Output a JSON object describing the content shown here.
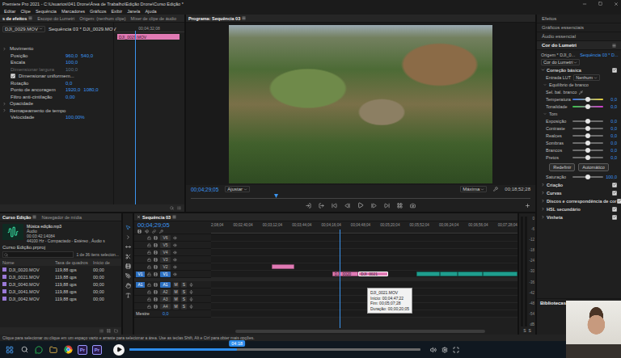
{
  "window": {
    "title": "Premiere Pro 2021 - C:\\Usuarios\\041 Drone\\Área de Trabalho\\Edição Drone\\Curso Edição *"
  },
  "menu": [
    "Editar",
    "Clipe",
    "Sequência",
    "Marcadores",
    "Gráficos",
    "Exibir",
    "Janela",
    "Ajuda"
  ],
  "effect_controls": {
    "tabs": [
      {
        "label": "s de efeitos",
        "selected": true
      },
      {
        "label": "Escopo do Lumetri",
        "selected": false
      },
      {
        "label": "Origem: (nenhum clipe)",
        "selected": false
      },
      {
        "label": "Mixer de clipe de áudio",
        "selected": false
      }
    ],
    "source": "DJI_0029.MOV",
    "sequence": "Sequência 03 * DJI_0029.MOV",
    "ruler_time": "00;04;32;08",
    "clip": "DJI_0029.MOV",
    "playhead": 0.3,
    "rows": [
      {
        "kind": "section",
        "label": "Movimento",
        "disabled": false
      },
      {
        "kind": "value",
        "label": "Posição",
        "values": [
          "960,0",
          "540,0"
        ],
        "disabled": false
      },
      {
        "kind": "value",
        "label": "Escala",
        "values": [
          "100,0"
        ],
        "disabled": false
      },
      {
        "kind": "value",
        "label": "Dimensionar largura",
        "values": [
          "100,0"
        ],
        "disabled": true
      },
      {
        "kind": "check",
        "label": "Dimensionar uniformem...",
        "checked": true,
        "disabled": false
      },
      {
        "kind": "value",
        "label": "Rotação",
        "values": [
          "0,0"
        ],
        "disabled": false
      },
      {
        "kind": "value",
        "label": "Ponto de ancoragem",
        "values": [
          "1920,0",
          "1080,0"
        ],
        "disabled": false
      },
      {
        "kind": "value",
        "label": "Filtro anti-cintilação",
        "values": [
          "0,00"
        ],
        "disabled": false
      },
      {
        "kind": "section",
        "label": "Opacidade",
        "disabled": false
      },
      {
        "kind": "section",
        "label": "Remapeamento de tempo",
        "disabled": false
      },
      {
        "kind": "value",
        "label": "Velocidade",
        "values": [
          "100,00%"
        ],
        "disabled": false
      }
    ]
  },
  "program": {
    "title": "Programa: Sequência 03",
    "timecode": "00;04;29;05",
    "fit": "Ajustar",
    "quality": "Máxima",
    "duration": "00;18;52;28",
    "playhead": 0.25
  },
  "lumetri": {
    "panels": [
      {
        "label": "Efeitos",
        "selected": false
      },
      {
        "label": "Gráficos essenciais",
        "selected": false
      },
      {
        "label": "Áudio essencial",
        "selected": false
      },
      {
        "label": "Cor do Lumetri",
        "selected": true
      }
    ],
    "source": "Origem * DJI_0...",
    "target": "Sequência 03 * D...",
    "effect": "Cor do Lumetri",
    "basic": {
      "label": "Correção básica",
      "checked": true
    },
    "lut_label": "Entrada LUT",
    "lut": "Nenhum",
    "wb": "Equilíbrio de branco",
    "wb_picker": "Sel. bal. branco",
    "wb_sliders": [
      {
        "label": "Temperatura",
        "value": "0,0",
        "level": 0.5,
        "kind": "temperature"
      },
      {
        "label": "Tonalidade",
        "value": "0,0",
        "level": 0.5,
        "kind": "tint"
      }
    ],
    "tone": "Tom",
    "tone_sliders": [
      {
        "label": "Exposição",
        "value": "0,0",
        "level": 0.5,
        "kind": "plain"
      },
      {
        "label": "Contraste",
        "value": "0,0",
        "level": 0.5,
        "kind": "plain"
      },
      {
        "label": "Realces",
        "value": "0,0",
        "level": 0.5,
        "kind": "plain"
      },
      {
        "label": "Sombras",
        "value": "0,0",
        "level": 0.5,
        "kind": "plain"
      },
      {
        "label": "Brancos",
        "value": "0,0",
        "level": 0.5,
        "kind": "plain"
      },
      {
        "label": "Pretos",
        "value": "0,0",
        "level": 0.5,
        "kind": "plain"
      }
    ],
    "buttons": [
      "Redefinir",
      "Automático"
    ],
    "saturation": {
      "label": "Saturação",
      "value": "100,0",
      "level": 0.5,
      "kind": "plain"
    },
    "sections": [
      {
        "label": "Criação",
        "checked": true
      },
      {
        "label": "Curvas",
        "checked": true
      },
      {
        "label": "Discos e correspondência de cor",
        "checked": true
      },
      {
        "label": "HSL secundário",
        "checked": true
      },
      {
        "label": "Vinheta",
        "checked": true
      }
    ],
    "libraries": "Bibliotecas"
  },
  "project": {
    "tabs": [
      {
        "label": "Curso Edição",
        "selected": true
      },
      {
        "label": "Navegador de mídia",
        "selected": false
      }
    ],
    "preview": [
      "Música edição.mp3",
      "Áudio",
      "00:03:42:14084",
      "44100 Hz - Compactado - Estéreo , Áudio s"
    ],
    "file": "Curso Edição.prproj",
    "count": "1 de 36 itens selecion...",
    "columns": [
      "Nome",
      "Taxa de quadros",
      "Início de"
    ],
    "rows": [
      {
        "name": "DJI_0020.MOV",
        "rate": "119,88 qps",
        "start": "00;00",
        "selected": false
      },
      {
        "name": "DJI_0021.MOV",
        "rate": "119,88 qps",
        "start": "00;00",
        "selected": false
      },
      {
        "name": "DJI_0040.MOV",
        "rate": "119,88 qps",
        "start": "00;00",
        "selected": false
      },
      {
        "name": "DJI_0041.MOV",
        "rate": "119,88 qps",
        "start": "00;00",
        "selected": false
      },
      {
        "name": "DJI_0042.MOV",
        "rate": "119,88 qps",
        "start": "00;00",
        "selected": false
      }
    ]
  },
  "timeline": {
    "tab": "Sequência 03",
    "timecode": "00;04;29;05",
    "ruler": [
      "2;08;04",
      "00;02;40;04",
      "00;03;12;04",
      "00;03;44;04",
      "00;04;16;04",
      "00;04;48;04",
      "00;05;20;04",
      "00;05;52;04",
      "00;06;24;04",
      "00;06;56;04",
      "00;07;28;04"
    ],
    "playhead": 0.42,
    "source_patches": {
      "video": "V1",
      "audio": "A1"
    },
    "video_tracks": [
      {
        "name": "V6",
        "target": false
      },
      {
        "name": "V5",
        "target": false
      },
      {
        "name": "V4",
        "target": false
      },
      {
        "name": "V3",
        "target": false
      },
      {
        "name": "V2",
        "target": false
      },
      {
        "name": "V1",
        "target": true
      }
    ],
    "audio_tracks": [
      {
        "name": "A1",
        "target": true
      },
      {
        "name": "A2",
        "target": false
      },
      {
        "name": "A3",
        "target": false
      },
      {
        "name": "A4",
        "target": false
      }
    ],
    "audio_buttons": [
      "M",
      "S"
    ],
    "master": {
      "name": "Mestre",
      "value": "0,0"
    },
    "clips": [
      {
        "track": "V2",
        "start": 0.197,
        "end": 0.273,
        "color": "#e07ab4",
        "selected": false
      },
      {
        "track": "V1",
        "label": "DJI_0020",
        "start": 0.395,
        "end": 0.481,
        "color": "#e07ab4",
        "selected": false
      },
      {
        "track": "V1",
        "label": "DJI_0021",
        "start": 0.481,
        "end": 0.578,
        "color": "#e07ab4",
        "selected": true
      },
      {
        "track": "V1",
        "start": 0.67,
        "end": 0.746,
        "color": "#1f9e8e",
        "selected": false
      },
      {
        "track": "V1",
        "start": 0.746,
        "end": 0.805,
        "color": "#1f9e8e",
        "selected": false
      },
      {
        "track": "V1",
        "start": 0.805,
        "end": 0.886,
        "color": "#1f9e8e",
        "selected": false
      },
      {
        "track": "V1",
        "start": 0.886,
        "end": 1,
        "color": "#1f9e8e",
        "selected": false
      }
    ],
    "tooltip": [
      "DJI_0021.MOV",
      "Início: 00;04;47;22",
      "Fim: 00;05;07;28",
      "Duração: 00;00;20;05"
    ]
  },
  "meters": {
    "labels": [
      "0",
      "-6",
      "-12",
      "-18",
      "-24",
      "-30",
      "-36",
      "-42",
      "-48",
      "-54",
      "dB"
    ],
    "solo": [
      "S",
      "S"
    ]
  },
  "status_bar": "Clique para selecionar ou clique em um espaço vazio e arraste para selecionar a área. Use as teclas Shift, Alt e Ctrl para obter mais opções.",
  "taskbar": {
    "apps": [
      {
        "label": "Pr"
      },
      {
        "label": "Pr"
      }
    ]
  },
  "player": {
    "time": "04:18",
    "level": 0.37
  }
}
